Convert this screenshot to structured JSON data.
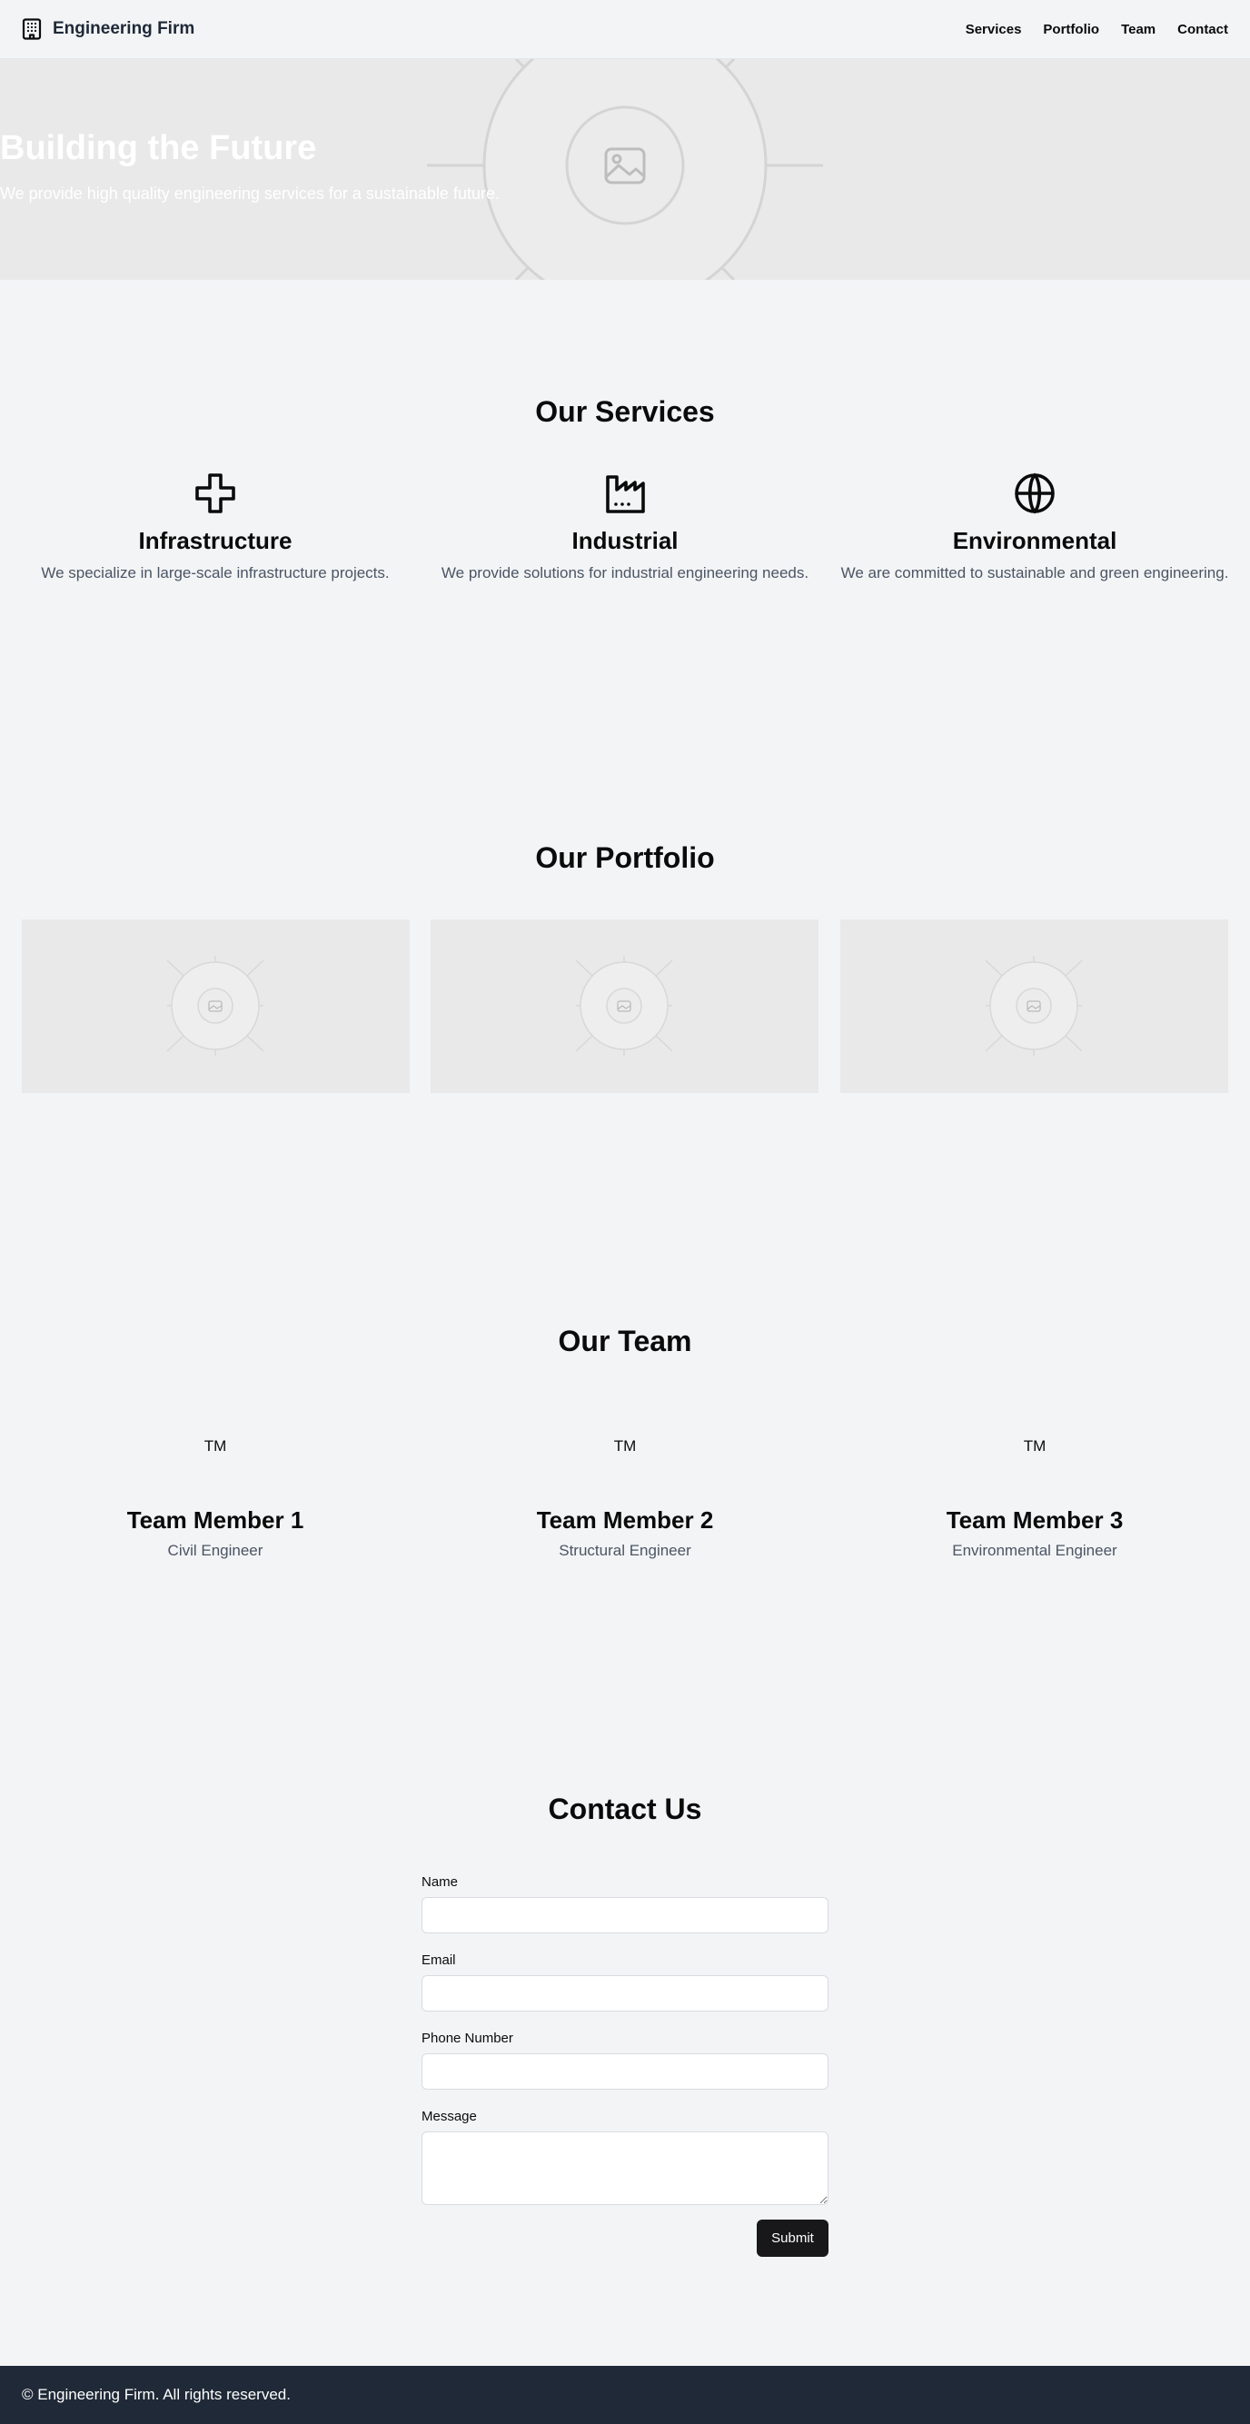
{
  "header": {
    "brand": "Engineering Firm",
    "nav": [
      "Services",
      "Portfolio",
      "Team",
      "Contact"
    ]
  },
  "hero": {
    "title": "Building the Future",
    "subtitle": "We provide high quality engineering services for a sustainable future."
  },
  "services": {
    "title": "Our Services",
    "items": [
      {
        "icon": "plus-icon",
        "title": "Infrastructure",
        "desc": "We specialize in large-scale infrastructure projects."
      },
      {
        "icon": "factory-icon",
        "title": "Industrial",
        "desc": "We provide solutions for industrial engineering needs."
      },
      {
        "icon": "globe-icon",
        "title": "Environmental",
        "desc": "We are committed to sustainable and green engineering."
      }
    ]
  },
  "portfolio": {
    "title": "Our Portfolio",
    "items": 3
  },
  "team": {
    "title": "Our Team",
    "members": [
      {
        "initials": "TM",
        "name": "Team Member 1",
        "role": "Civil Engineer"
      },
      {
        "initials": "TM",
        "name": "Team Member 2",
        "role": "Structural Engineer"
      },
      {
        "initials": "TM",
        "name": "Team Member 3",
        "role": "Environmental Engineer"
      }
    ]
  },
  "contact": {
    "title": "Contact Us",
    "fields": [
      "Name",
      "Email",
      "Phone Number",
      "Message"
    ],
    "submit": "Submit"
  },
  "footer": {
    "text": "© Engineering Firm. All rights reserved."
  },
  "colors": {
    "background": "#f3f4f6",
    "footer": "#1f2937",
    "button": "#18181b",
    "muted_text": "#4b5563"
  }
}
